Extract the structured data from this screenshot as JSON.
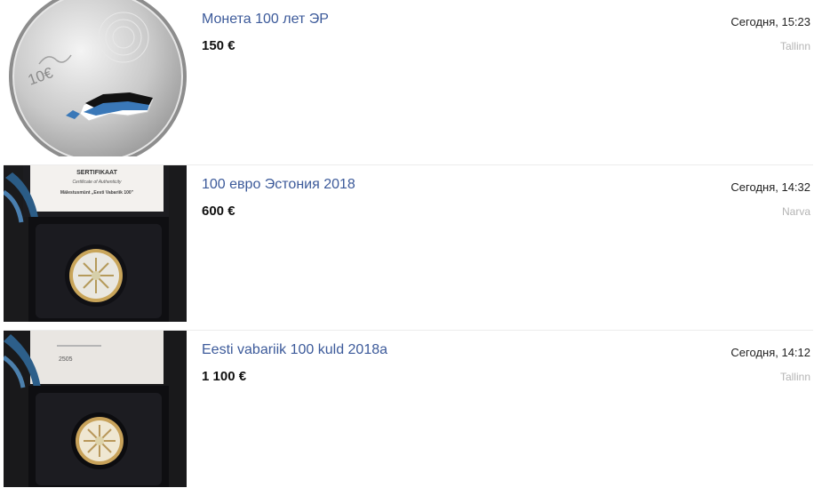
{
  "listings": [
    {
      "title": "Монета 100 лет ЭР",
      "price": "150 €",
      "date": "Сегодня, 15:23",
      "city": "Tallinn",
      "coin_denomination": "10€"
    },
    {
      "title": "100 евро Эстония 2018",
      "price": "600 €",
      "date": "Сегодня, 14:32",
      "city": "Narva",
      "cert_title": "SERTIFIKAAT",
      "cert_subtitle": "Certificate of Authenticity",
      "cert_name": "Mälestusmünt „Eesti Vabariik 100\""
    },
    {
      "title": "Eesti vabariik 100 kuld 2018a",
      "price": "1 100 €",
      "date": "Сегодня, 14:12",
      "city": "Tallinn",
      "cert_number": "2505"
    }
  ]
}
